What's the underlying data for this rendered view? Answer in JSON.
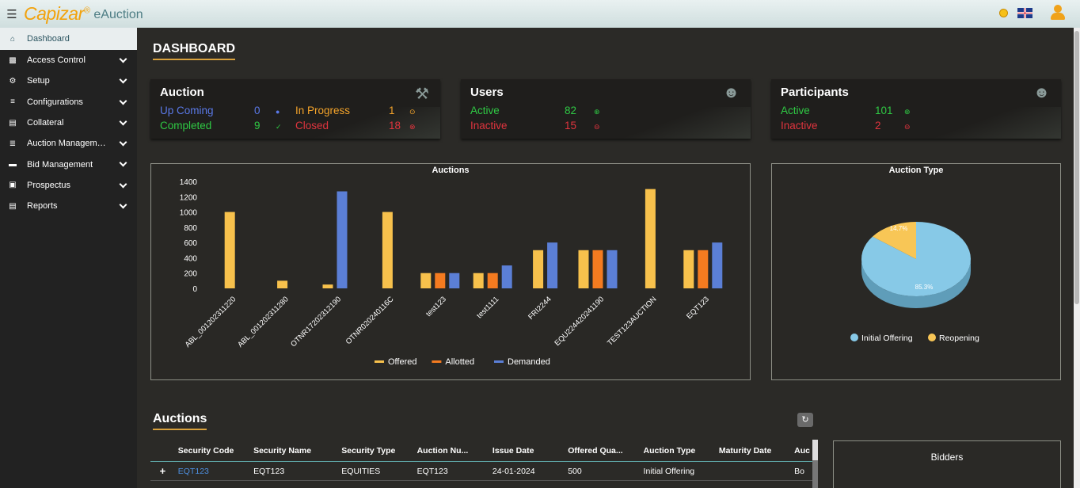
{
  "app": {
    "brand": "Capizar",
    "brand_mark": "®",
    "brand_sub": "eAuction"
  },
  "sidebar": {
    "items": [
      {
        "label": "Dashboard",
        "icon": "home-icon"
      },
      {
        "label": "Access Control",
        "icon": "lock-icon"
      },
      {
        "label": "Setup",
        "icon": "gear-icon"
      },
      {
        "label": "Configurations",
        "icon": "sliders-icon"
      },
      {
        "label": "Collateral",
        "icon": "document-icon"
      },
      {
        "label": "Auction Management",
        "icon": "list-icon"
      },
      {
        "label": "Bid Management",
        "icon": "card-icon"
      },
      {
        "label": "Prospectus",
        "icon": "book-icon"
      },
      {
        "label": "Reports",
        "icon": "report-icon"
      }
    ]
  },
  "dashboard": {
    "title": "DASHBOARD",
    "auction_card": {
      "title": "Auction",
      "upcoming_label": "Up Coming",
      "upcoming_value": "0",
      "inprogress_label": "In Progress",
      "inprogress_value": "1",
      "completed_label": "Completed",
      "completed_value": "9",
      "closed_label": "Closed",
      "closed_value": "18"
    },
    "users_card": {
      "title": "Users",
      "active_label": "Active",
      "active_value": "82",
      "inactive_label": "Inactive",
      "inactive_value": "15"
    },
    "participants_card": {
      "title": "Participants",
      "active_label": "Active",
      "active_value": "101",
      "inactive_label": "Inactive",
      "inactive_value": "2"
    }
  },
  "colors": {
    "offered": "#f7c14c",
    "allotted": "#f47b20",
    "demanded": "#5b7fd6",
    "initial_offering": "#87c9e7",
    "reopening": "#f8c656",
    "accent": "#d8a13d"
  },
  "chart_data": [
    {
      "type": "bar",
      "title": "Auctions",
      "categories": [
        "ABL_001202311220",
        "ABL_001202311280",
        "OTNR17202312190",
        "OTNR020240116C",
        "test123",
        "test1111",
        "FRI2244",
        "EQU224420241190",
        "TEST123AUCTION",
        "EQT123"
      ],
      "series": [
        {
          "name": "Offered",
          "values": [
            1000,
            100,
            50,
            1000,
            200,
            200,
            500,
            500,
            1300,
            500
          ]
        },
        {
          "name": "Allotted",
          "values": [
            0,
            0,
            0,
            0,
            200,
            200,
            0,
            500,
            0,
            500
          ]
        },
        {
          "name": "Demanded",
          "values": [
            0,
            0,
            1270,
            0,
            200,
            300,
            600,
            500,
            0,
            600
          ]
        }
      ],
      "yticks": [
        "0",
        "200",
        "400",
        "600",
        "800",
        "1000",
        "1200",
        "1400"
      ],
      "ylim": [
        0,
        1400
      ]
    },
    {
      "type": "pie",
      "title": "Auction Type",
      "labels": [
        "Initial Offering",
        "Reopening"
      ],
      "values": [
        85.3,
        14.7
      ],
      "value_labels": [
        "85.3%",
        "14.7%"
      ]
    }
  ],
  "auctions": {
    "title": "Auctions",
    "refresh_icon": "refresh-icon",
    "columns": [
      "Security Code",
      "Security Name",
      "Security Type",
      "Auction Nu...",
      "Issue Date",
      "Offered Qua...",
      "Auction Type",
      "Maturity Date",
      "Auc"
    ],
    "rows": [
      {
        "expand": "+",
        "security_code": "EQT123",
        "security_name": "EQT123",
        "security_type": "EQUITIES",
        "auction_number": "EQT123",
        "issue_date": "24-01-2024",
        "offered_qty": "500",
        "auction_type": "Initial Offering",
        "maturity_date": "",
        "auc": "Bo"
      }
    ]
  },
  "bidders": {
    "title": "Bidders"
  }
}
